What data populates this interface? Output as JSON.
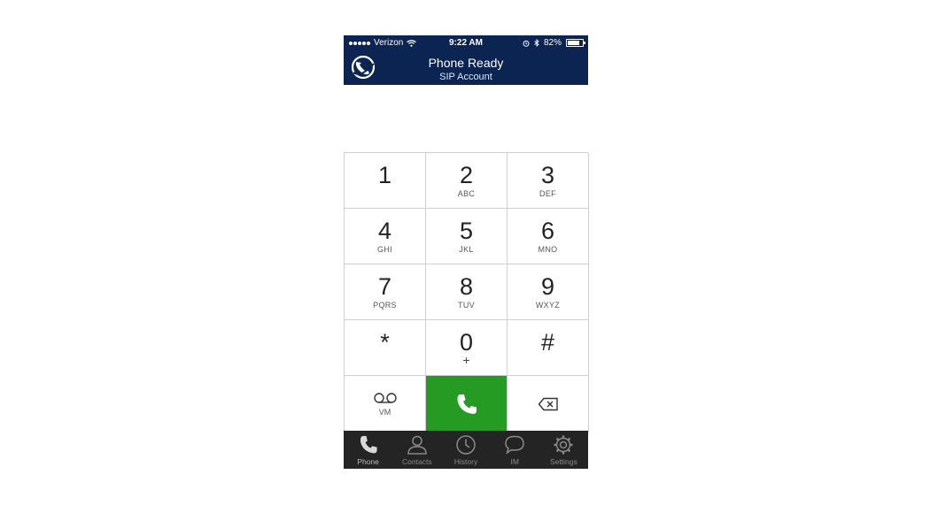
{
  "status_bar": {
    "carrier": "Verizon",
    "time": "9:22 AM",
    "battery": "82%"
  },
  "header": {
    "title": "Phone Ready",
    "subtitle": "SIP Account"
  },
  "keypad": {
    "keys": [
      {
        "digit": "1",
        "letters": ""
      },
      {
        "digit": "2",
        "letters": "ABC"
      },
      {
        "digit": "3",
        "letters": "DEF"
      },
      {
        "digit": "4",
        "letters": "GHI"
      },
      {
        "digit": "5",
        "letters": "JKL"
      },
      {
        "digit": "6",
        "letters": "MNO"
      },
      {
        "digit": "7",
        "letters": "PQRS"
      },
      {
        "digit": "8",
        "letters": "TUV"
      },
      {
        "digit": "9",
        "letters": "WXYZ"
      },
      {
        "digit": "*",
        "letters": ""
      },
      {
        "digit": "0",
        "letters": "+"
      },
      {
        "digit": "#",
        "letters": ""
      }
    ],
    "voicemail_label": "VM",
    "call_color": "#259b24"
  },
  "tabs": [
    {
      "label": "Phone",
      "icon": "phone-icon",
      "active": true
    },
    {
      "label": "Contacts",
      "icon": "contacts-icon"
    },
    {
      "label": "History",
      "icon": "clock-icon"
    },
    {
      "label": "IM",
      "icon": "chat-bubble-icon"
    },
    {
      "label": "Settings",
      "icon": "gear-icon"
    }
  ],
  "colors": {
    "header_bg": "#0c2451",
    "tabbar_bg": "#242424",
    "call_green": "#259b24"
  }
}
